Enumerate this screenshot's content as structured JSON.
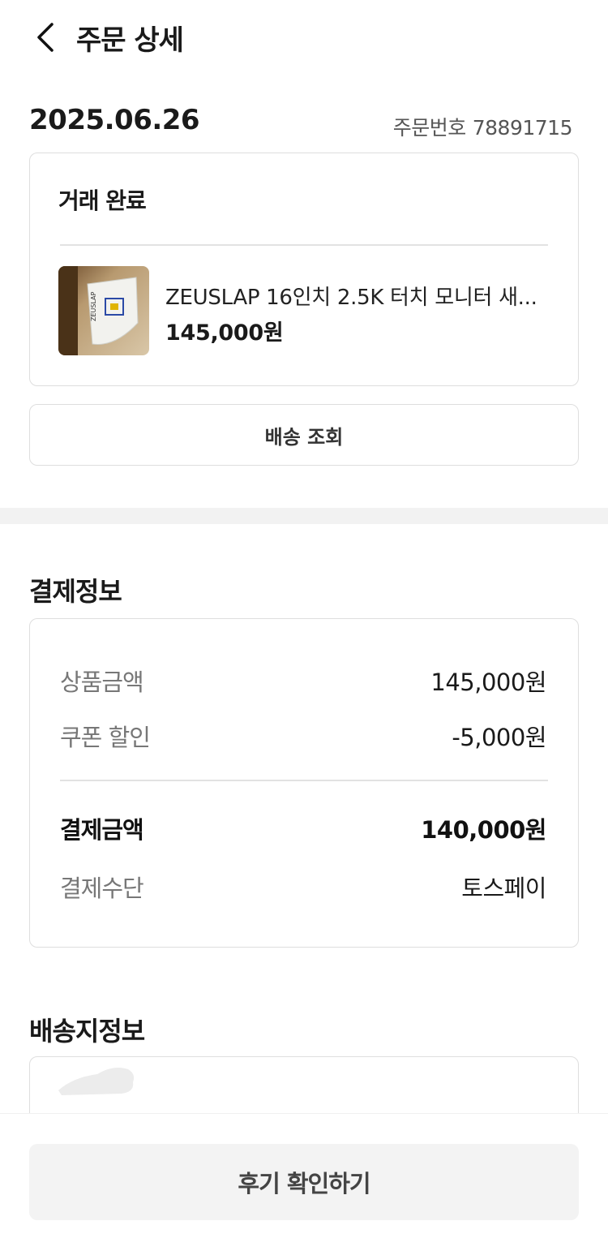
{
  "header": {
    "title": "주문 상세"
  },
  "order": {
    "date": "2025.06.26",
    "number_label": "주문번호",
    "number": "78891715"
  },
  "status": {
    "label": "거래 완료"
  },
  "product": {
    "name": "ZEUSLAP 16인치 2.5K 터치 모니터 새...",
    "price": "145,000원",
    "thumb_text": "ZEUSLAP"
  },
  "tracking": {
    "button_label": "배송 조회"
  },
  "payment": {
    "title": "결제정보",
    "rows": [
      {
        "label": "상품금액",
        "value": "145,000원"
      },
      {
        "label": "쿠폰 할인",
        "value": "-5,000원"
      }
    ],
    "total_label": "결제금액",
    "total_value": "140,000원",
    "method_label": "결제수단",
    "method_value": "토스페이"
  },
  "shipping": {
    "title": "배송지정보"
  },
  "bottom": {
    "review_button": "후기 확인하기"
  },
  "colors": {
    "border": "#dedede",
    "muted_text": "#777777",
    "button_bg": "#f3f3f3"
  },
  "icons": {
    "back": "chevron-left-icon"
  }
}
